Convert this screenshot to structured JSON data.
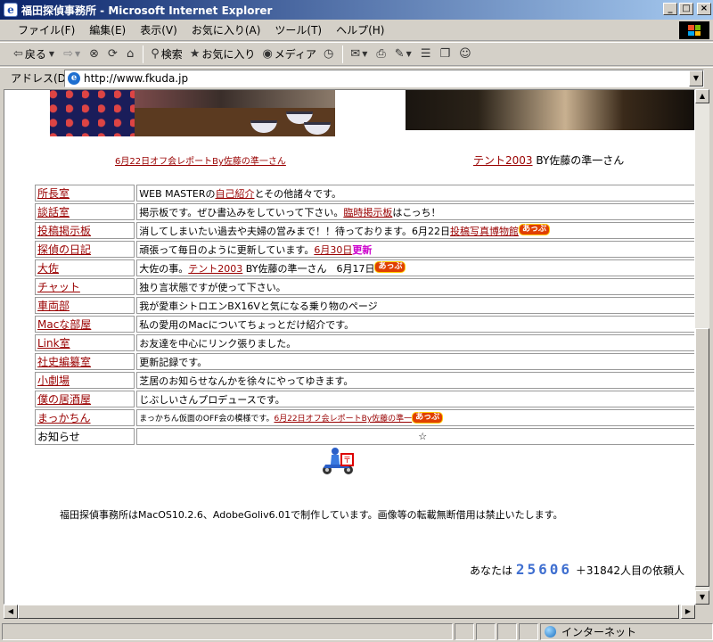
{
  "window": {
    "title": "福田探偵事務所 - Microsoft Internet Explorer",
    "app_icon": "e"
  },
  "menubar": [
    "ファイル(F)",
    "編集(E)",
    "表示(V)",
    "お気に入り(A)",
    "ツール(T)",
    "ヘルプ(H)"
  ],
  "toolbar": {
    "back_label": "戻る",
    "search_label": "検索",
    "favorites_label": "お気に入り",
    "media_label": "メディア"
  },
  "address": {
    "label": "アドレス(D)",
    "url": "http://www.fkuda.jp"
  },
  "page": {
    "caption_left": "6月22日オフ会レポートBy佐藤の準一さん",
    "caption_right_link": "テント2003",
    "caption_right_text": " BY佐藤の準一さん",
    "rows": [
      {
        "name": "所長室",
        "desc": [
          {
            "t": "WEB MASTERの"
          },
          {
            "t": "自己紹介",
            "link": true
          },
          {
            "t": "とその他諸々です。"
          }
        ]
      },
      {
        "name": "談話室",
        "desc": [
          {
            "t": "掲示板です。ぜひ書込みをしていって下さい。"
          },
          {
            "t": "臨時掲示板",
            "link": true
          },
          {
            "t": "はこっち！"
          }
        ]
      },
      {
        "name": "投稿掲示板",
        "desc": [
          {
            "t": "消してしまいたい過去や夫婦の営みまで！！待っております。6月22日"
          },
          {
            "t": "投稿写真博物館",
            "link": true
          },
          {
            "t": "あっぷ",
            "badge": true
          }
        ]
      },
      {
        "name": "探偵の日記",
        "desc": [
          {
            "t": "頑張って毎日のように更新しています。"
          },
          {
            "t": "6月30日",
            "link": true
          },
          {
            "t": "更新",
            "upd": true
          }
        ]
      },
      {
        "name": "大佐",
        "desc": [
          {
            "t": "大佐の事。"
          },
          {
            "t": "テント2003",
            "link": true
          },
          {
            "t": " BY佐藤の準一さん　6月17日"
          },
          {
            "t": "あっぷ",
            "badge": true
          }
        ]
      },
      {
        "name": "チャット",
        "desc": [
          {
            "t": "独り言状態ですが使って下さい。"
          }
        ]
      },
      {
        "name": "車両部",
        "desc": [
          {
            "t": "我が愛車シトロエンBX16Vと気になる乗り物のページ"
          }
        ]
      },
      {
        "name": "Macな部屋",
        "desc": [
          {
            "t": "私の愛用のMacについてちょっとだけ紹介です。"
          }
        ]
      },
      {
        "name": "Link室",
        "desc": [
          {
            "t": "お友達を中心にリンク張りました。"
          }
        ]
      },
      {
        "name": "社史編纂室",
        "desc": [
          {
            "t": "更新記録です。"
          }
        ]
      },
      {
        "name": "小劇場",
        "desc": [
          {
            "t": "芝居のお知らせなんかを徐々にやってゆきます。"
          }
        ]
      },
      {
        "name": "僕の居酒屋",
        "desc": [
          {
            "t": "じぶしいさんプロデュースです。"
          }
        ]
      },
      {
        "name": "まっかちん",
        "desc": [
          {
            "t": "まっかちん仮面のOFF会の模様です。",
            "small": true
          },
          {
            "t": "6月22日オフ会レポートBy佐藤の準一",
            "link": true,
            "small": true
          },
          {
            "t": "あっぷ",
            "badge": true
          }
        ]
      }
    ],
    "notice_label": "お知らせ",
    "notice_value": "☆",
    "footer_text": "福田探偵事務所はMacOS10.2.6、AdobeGoliv6.01で制作しています。画像等の転載無断借用は禁止いたします。",
    "counter_prefix": "あなたは",
    "counter_digits": "25606",
    "counter_suffix": "＋31842人目の依頼人"
  },
  "status": {
    "zone_label": "インターネット"
  },
  "colors": {
    "link": "#990000",
    "update": "#cc00cc",
    "counter": "#3f6fd0",
    "badge": "#e04000"
  }
}
